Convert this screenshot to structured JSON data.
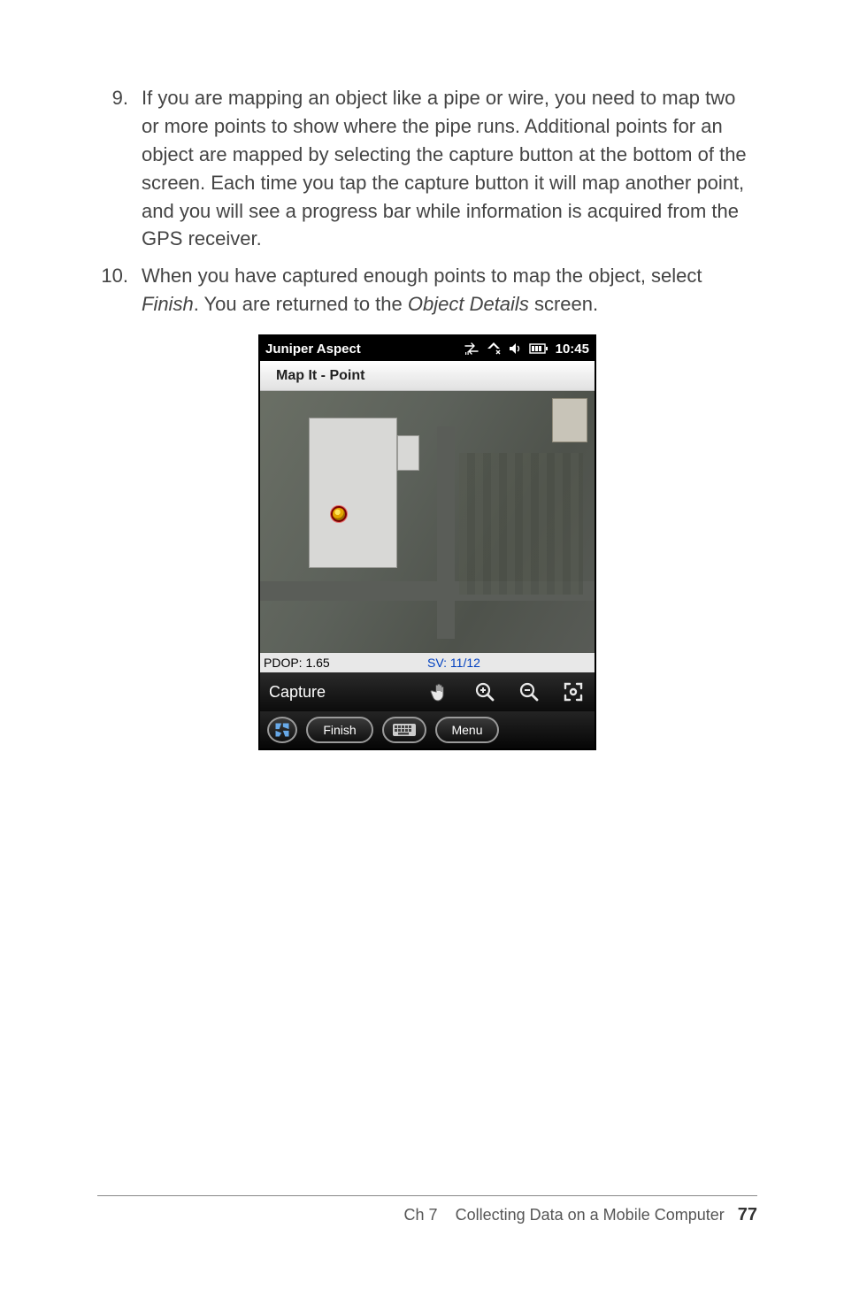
{
  "steps": [
    {
      "num": "9.",
      "text_pre": "If you are mapping an object like a pipe or wire, you need to map two or more points to show where the pipe runs. Additional points for an object are mapped by selecting the capture button at the bottom of the screen. Each time you tap the capture button it will map another point, and you will see a progress bar while information is acquired from the GPS receiver."
    },
    {
      "num": "10.",
      "text_pre": "When you have captured enough points to map the object, select ",
      "italic1": "Finish",
      "mid": ". You are returned to the ",
      "italic2": "Object Details",
      "post": " screen."
    }
  ],
  "screenshot": {
    "status_title": "Juniper Aspect",
    "clock": "10:45",
    "title": "Map It - Point",
    "pdop_label": "PDOP: 1.65",
    "sv_label": "SV: 11/12",
    "capture_label": "Capture",
    "finish_label": "Finish",
    "menu_label": "Menu"
  },
  "footer": {
    "chapter": "Ch 7",
    "title": "Collecting Data on a Mobile Computer",
    "page": "77"
  }
}
